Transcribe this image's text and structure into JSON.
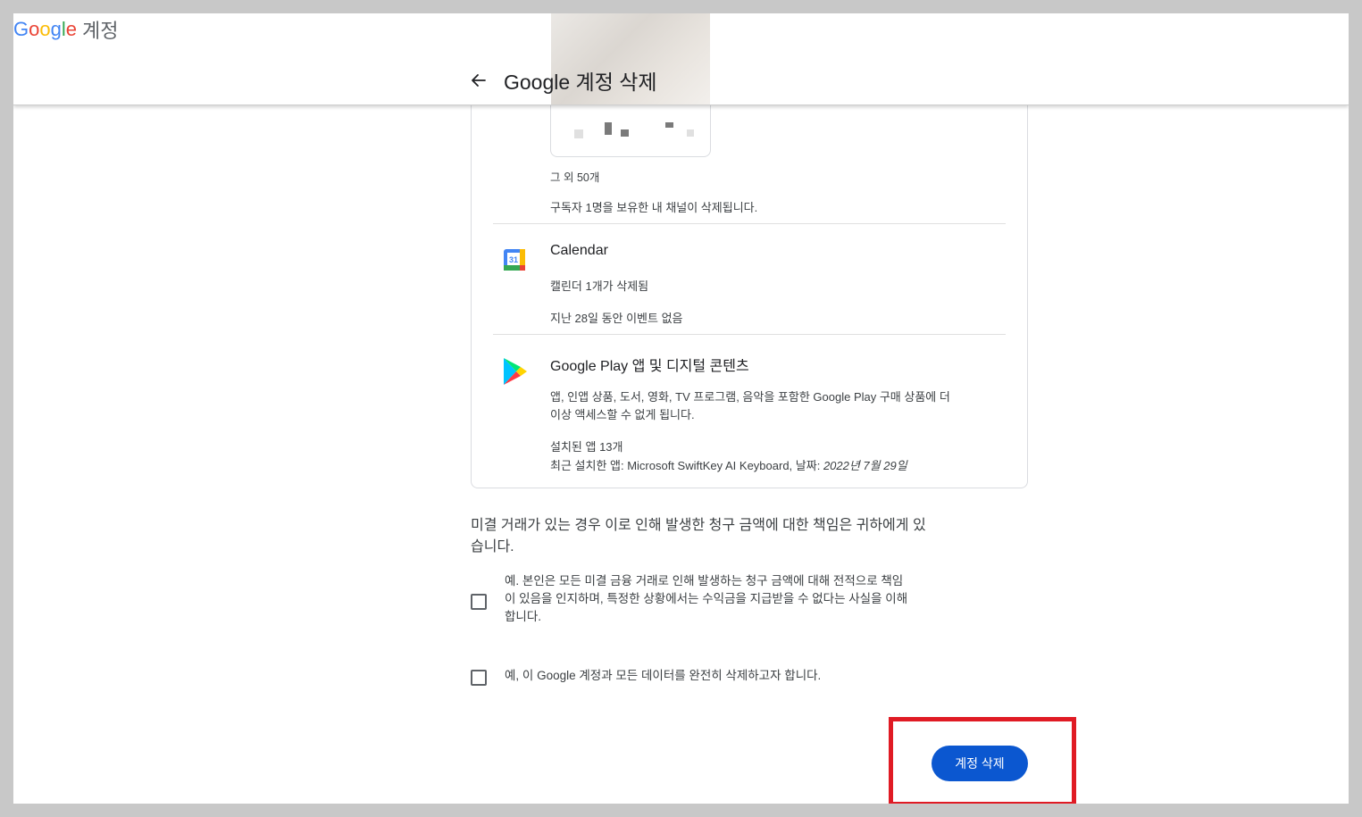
{
  "header": {
    "logo_google": "Google",
    "logo_account": "계정",
    "page_title": "Google 계정 삭제"
  },
  "youtube": {
    "more_count": "그 외 50개",
    "channel_note": "구독자 1명을 보유한 내 채널이 삭제됩니다."
  },
  "calendar": {
    "title": "Calendar",
    "icon_text": "31",
    "line1": "캘린더 1개가 삭제됨",
    "line2": "지난 28일 동안 이벤트 없음"
  },
  "play": {
    "title": "Google Play 앱 및 디지털 콘텐츠",
    "desc_line1": "앱, 인앱 상품, 도서, 영화, TV 프로그램, 음악을 포함한 Google Play 구매 상품에 더",
    "desc_line2": "이상 액세스할 수 없게 됩니다.",
    "installed": "설치된 앱 13개",
    "recent_prefix": "최근 설치한 앱: Microsoft SwiftKey AI Keyboard, 날짜: ",
    "recent_date": "2022년 7월 29일"
  },
  "notice": {
    "line1": "미결 거래가 있는 경우 이로 인해 발생한 청구 금액에 대한 책임은 귀하에게 있",
    "line2": "습니다."
  },
  "checkbox1": {
    "line1": "예. 본인은 모든 미결 금융 거래로 인해 발생하는 청구 금액에 대해 전적으로 책임",
    "line2": "이 있음을 인지하며, 특정한 상황에서는 수익금을 지급받을 수 없다는 사실을 이해",
    "line3": "합니다."
  },
  "checkbox2": {
    "label": "예, 이 Google 계정과 모든 데이터를 완전히 삭제하고자 합니다."
  },
  "actions": {
    "delete_label": "계정 삭제"
  },
  "colors": {
    "primary_button": "#0b57d0",
    "highlight_box": "#e01b24"
  }
}
